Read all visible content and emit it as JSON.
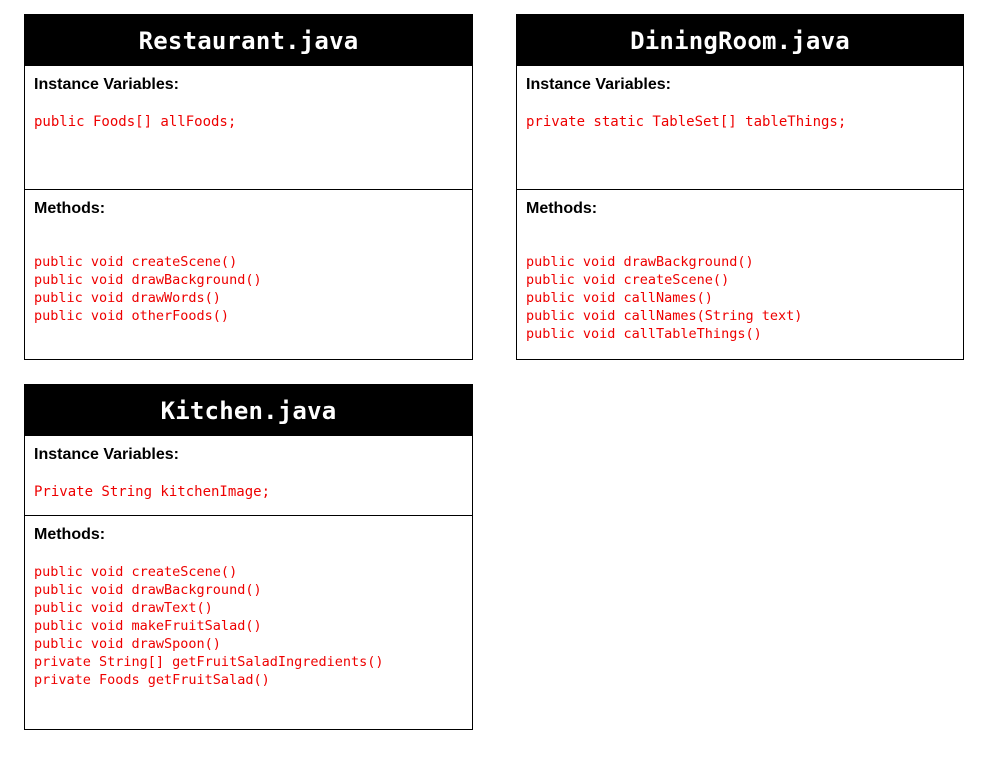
{
  "cards": {
    "restaurant": {
      "title": "Restaurant.java",
      "vars_heading": "Instance Variables:",
      "vars": [
        "public Foods[] allFoods;"
      ],
      "methods_heading": "Methods:",
      "methods": [
        "public void createScene()",
        "public void drawBackground()",
        "public void drawWords()",
        "public void otherFoods()"
      ]
    },
    "dining": {
      "title": "DiningRoom.java",
      "vars_heading": "Instance Variables:",
      "vars": [
        "private static TableSet[] tableThings;"
      ],
      "methods_heading": "Methods:",
      "methods": [
        "public void drawBackground()",
        "public void createScene()",
        "public void callNames()",
        "public void callNames(String text)",
        "public void callTableThings()"
      ]
    },
    "kitchen": {
      "title": "Kitchen.java",
      "vars_heading": "Instance Variables:",
      "vars": [
        "Private String kitchenImage;"
      ],
      "methods_heading": "Methods:",
      "methods": [
        "public void createScene()",
        "public void drawBackground()",
        "public void drawText()",
        "public void makeFruitSalad()",
        "public void drawSpoon()",
        "private String[] getFruitSaladIngredients()",
        "private Foods getFruitSalad()"
      ]
    }
  },
  "colors": {
    "header_bg": "#000000",
    "header_text": "#ffffff",
    "code_text": "#ee0000",
    "border": "#000000"
  }
}
